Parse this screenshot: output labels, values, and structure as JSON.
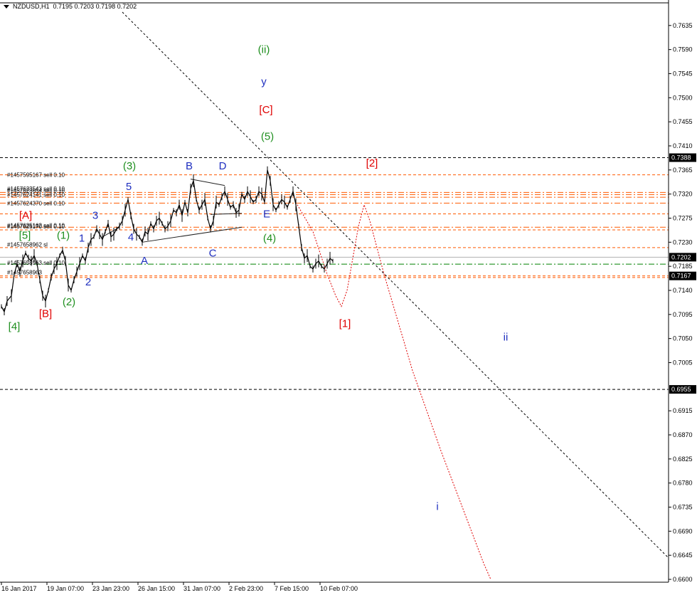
{
  "header": {
    "symbol": "NZDUSD,H1",
    "ohlc": "0.7195 0.7203 0.7198 0.7202"
  },
  "colors": {
    "background": "#ffffff",
    "price": "#000000",
    "sell_line": "#ff5a00",
    "bid_line": "#008000",
    "projection": "#e00000",
    "trendline": "#000000",
    "label_red": "#e00000",
    "label_green": "#1f8f1f",
    "label_blue": "#1f2fbf"
  },
  "chart_data": {
    "type": "line",
    "subtype": "candlestick price chart with Elliott wave markup",
    "symbol": "NZDUSD",
    "timeframe": "H1",
    "y_range": [
      0.66,
      0.766
    ],
    "y_ticks": [
      "0.7635",
      "0.7590",
      "0.7545",
      "0.7500",
      "0.7455",
      "0.7410",
      "0.7365",
      "0.7320",
      "0.7275",
      "0.7230",
      "0.7185",
      "0.7140",
      "0.7095",
      "0.7050",
      "0.7005",
      "0.6915",
      "0.6870",
      "0.6825",
      "0.6780",
      "0.6735",
      "0.6690",
      "0.6645",
      "0.6600"
    ],
    "x_range": [
      0,
      940
    ],
    "x_ticks": [
      {
        "label": "16 Jan 2017",
        "x": 2
      },
      {
        "label": "19 Jan 07:00",
        "x": 66
      },
      {
        "label": "23 Jan 23:00",
        "x": 130
      },
      {
        "label": "26 Jan 15:00",
        "x": 194
      },
      {
        "label": "31 Jan 07:00",
        "x": 258
      },
      {
        "label": "2 Feb 23:00",
        "x": 322
      },
      {
        "label": "7 Feb 15:00",
        "x": 386
      },
      {
        "label": "10 Feb 07:00",
        "x": 450
      }
    ],
    "price_series": {
      "name": "NZDUSD",
      "points": [
        [
          2,
          0.711
        ],
        [
          6,
          0.71
        ],
        [
          10,
          0.712
        ],
        [
          16,
          0.713
        ],
        [
          20,
          0.717
        ],
        [
          24,
          0.719
        ],
        [
          28,
          0.7175
        ],
        [
          32,
          0.7195
        ],
        [
          36,
          0.721
        ],
        [
          40,
          0.72
        ],
        [
          44,
          0.7195
        ],
        [
          48,
          0.7205
        ],
        [
          52,
          0.719
        ],
        [
          56,
          0.716
        ],
        [
          60,
          0.713
        ],
        [
          64,
          0.712
        ],
        [
          68,
          0.714
        ],
        [
          72,
          0.7165
        ],
        [
          76,
          0.718
        ],
        [
          80,
          0.719
        ],
        [
          84,
          0.7205
        ],
        [
          88,
          0.7215
        ],
        [
          92,
          0.7195
        ],
        [
          96,
          0.715
        ],
        [
          100,
          0.714
        ],
        [
          104,
          0.716
        ],
        [
          108,
          0.7175
        ],
        [
          112,
          0.719
        ],
        [
          116,
          0.7205
        ],
        [
          120,
          0.7195
        ],
        [
          124,
          0.722
        ],
        [
          128,
          0.7235
        ],
        [
          132,
          0.724
        ],
        [
          136,
          0.7255
        ],
        [
          140,
          0.7245
        ],
        [
          144,
          0.7235
        ],
        [
          148,
          0.725
        ],
        [
          152,
          0.7265
        ],
        [
          156,
          0.724
        ],
        [
          160,
          0.7245
        ],
        [
          164,
          0.7255
        ],
        [
          168,
          0.726
        ],
        [
          172,
          0.727
        ],
        [
          176,
          0.729
        ],
        [
          180,
          0.731
        ],
        [
          184,
          0.728
        ],
        [
          188,
          0.7255
        ],
        [
          192,
          0.7245
        ],
        [
          196,
          0.724
        ],
        [
          200,
          0.723
        ],
        [
          204,
          0.725
        ],
        [
          208,
          0.7245
        ],
        [
          212,
          0.7265
        ],
        [
          216,
          0.7255
        ],
        [
          220,
          0.727
        ],
        [
          224,
          0.7275
        ],
        [
          228,
          0.7265
        ],
        [
          232,
          0.7255
        ],
        [
          236,
          0.726
        ],
        [
          240,
          0.727
        ],
        [
          244,
          0.729
        ],
        [
          248,
          0.7285
        ],
        [
          252,
          0.73
        ],
        [
          256,
          0.728
        ],
        [
          260,
          0.7305
        ],
        [
          264,
          0.7285
        ],
        [
          268,
          0.733
        ],
        [
          272,
          0.7345
        ],
        [
          276,
          0.731
        ],
        [
          280,
          0.729
        ],
        [
          284,
          0.73
        ],
        [
          288,
          0.731
        ],
        [
          292,
          0.7275
        ],
        [
          296,
          0.7255
        ],
        [
          300,
          0.727
        ],
        [
          304,
          0.7305
        ],
        [
          308,
          0.73
        ],
        [
          312,
          0.7315
        ],
        [
          316,
          0.7325
        ],
        [
          320,
          0.731
        ],
        [
          324,
          0.7295
        ],
        [
          328,
          0.73
        ],
        [
          332,
          0.7285
        ],
        [
          336,
          0.729
        ],
        [
          340,
          0.732
        ],
        [
          344,
          0.731
        ],
        [
          348,
          0.7325
        ],
        [
          352,
          0.7315
        ],
        [
          356,
          0.7305
        ],
        [
          360,
          0.731
        ],
        [
          364,
          0.7325
        ],
        [
          368,
          0.732
        ],
        [
          372,
          0.7305
        ],
        [
          376,
          0.7365
        ],
        [
          380,
          0.7345
        ],
        [
          384,
          0.73
        ],
        [
          388,
          0.729
        ],
        [
          392,
          0.73
        ],
        [
          396,
          0.731
        ],
        [
          400,
          0.7305
        ],
        [
          404,
          0.7295
        ],
        [
          408,
          0.731
        ],
        [
          412,
          0.7325
        ],
        [
          416,
          0.73
        ],
        [
          420,
          0.726
        ],
        [
          424,
          0.722
        ],
        [
          428,
          0.72
        ],
        [
          432,
          0.7205
        ],
        [
          436,
          0.7185
        ],
        [
          440,
          0.718
        ],
        [
          444,
          0.719
        ],
        [
          448,
          0.7195
        ],
        [
          452,
          0.7185
        ],
        [
          456,
          0.718
        ],
        [
          460,
          0.719
        ],
        [
          464,
          0.72
        ],
        [
          468,
          0.7195
        ]
      ]
    },
    "horizontal_lines": [
      {
        "price": 0.7388,
        "style": "dashed",
        "color": "#000000",
        "marker": "0.7388"
      },
      {
        "price": 0.7356,
        "style": "dashed",
        "color": "#ff5a00"
      },
      {
        "price": 0.7323,
        "style": "dashdot",
        "color": "#ff5a00"
      },
      {
        "price": 0.7319,
        "style": "dashdot",
        "color": "#ff5a00"
      },
      {
        "price": 0.7314,
        "style": "dashdot",
        "color": "#ff5a00"
      },
      {
        "price": 0.7303,
        "style": "dashdot",
        "color": "#ff5a00"
      },
      {
        "price": 0.7283,
        "style": "dashed",
        "color": "#ff5a00"
      },
      {
        "price": 0.7258,
        "style": "dashdot",
        "color": "#ff5a00"
      },
      {
        "price": 0.7253,
        "style": "dashed",
        "color": "#ff5a00"
      },
      {
        "price": 0.722,
        "style": "dashed",
        "color": "#ff5a00"
      },
      {
        "price": 0.7202,
        "style": "solid",
        "color": "#b0b0b0",
        "marker": "0.7202"
      },
      {
        "price": 0.7189,
        "style": "dashdot",
        "color": "#008000"
      },
      {
        "price": 0.7167,
        "style": "dashed",
        "color": "#ff5a00",
        "marker": "0.7167"
      },
      {
        "price": 0.7164,
        "style": "dashed",
        "color": "#ff5a00"
      },
      {
        "price": 0.6955,
        "style": "dashed",
        "color": "#000000",
        "marker": "0.6955"
      }
    ],
    "order_labels": [
      {
        "text": "#1457595167 sell 0.10",
        "price": 0.7356
      },
      {
        "text": "#1457623543 sell 0.10",
        "price": 0.733
      },
      {
        "text": "#1457623654 sell 0.10",
        "price": 0.7327
      },
      {
        "text": "#1457624141 sell 0.10",
        "price": 0.7319
      },
      {
        "text": "#1457624370 sell 0.10",
        "price": 0.7303
      },
      {
        "text": "#1457625162 sell 0.10",
        "price": 0.7262
      },
      {
        "text": "#1457625170 sell 0.10",
        "price": 0.726
      },
      {
        "text": "#1457658962 sl",
        "price": 0.7226
      },
      {
        "text": "#1457658963 sell 0.10",
        "price": 0.7192
      },
      {
        "text": "#1457658963",
        "price": 0.7174
      }
    ],
    "projection_path": [
      [
        418,
        0.73
      ],
      [
        440,
        0.725
      ],
      [
        460,
        0.717
      ],
      [
        472,
        0.713
      ],
      [
        480,
        0.711
      ],
      [
        488,
        0.714
      ],
      [
        496,
        0.72
      ],
      [
        504,
        0.726
      ],
      [
        512,
        0.73
      ],
      [
        520,
        0.727
      ],
      [
        540,
        0.717
      ],
      [
        560,
        0.708
      ],
      [
        580,
        0.699
      ],
      [
        600,
        0.6915
      ],
      [
        620,
        0.684
      ],
      [
        640,
        0.677
      ],
      [
        660,
        0.67
      ],
      [
        680,
        0.663
      ],
      [
        690,
        0.66
      ]
    ],
    "trendline": [
      [
        172,
        0.766
      ],
      [
        940,
        0.664
      ]
    ],
    "triangle_lines": [
      [
        [
          268,
          0.7348
        ],
        [
          316,
          0.7336
        ]
      ],
      [
        [
          200,
          0.723
        ],
        [
          340,
          0.7258
        ]
      ],
      [
        [
          296,
          0.7282
        ],
        [
          340,
          0.7284
        ]
      ]
    ],
    "small_channel": [
      [
        144,
        0.724
      ],
      [
        168,
        0.7258
      ]
    ],
    "wave_labels": [
      {
        "text": "(ii)",
        "x": 371,
        "price": 0.759,
        "color": "green"
      },
      {
        "text": "y",
        "x": 371,
        "price": 0.753,
        "color": "blue"
      },
      {
        "text": "[C]",
        "x": 374,
        "price": 0.7478,
        "color": "red"
      },
      {
        "text": "(5)",
        "x": 376,
        "price": 0.7428,
        "color": "green"
      },
      {
        "text": "(3)",
        "x": 182,
        "price": 0.7373,
        "color": "green"
      },
      {
        "text": "B",
        "x": 266,
        "price": 0.7373,
        "color": "blue"
      },
      {
        "text": "D",
        "x": 313,
        "price": 0.7373,
        "color": "blue"
      },
      {
        "text": "[2]",
        "x": 523,
        "price": 0.7378,
        "color": "red"
      },
      {
        "text": "5",
        "x": 181,
        "price": 0.7334,
        "color": "blue"
      },
      {
        "text": "3",
        "x": 134,
        "price": 0.728,
        "color": "blue"
      },
      {
        "text": "E",
        "x": 375,
        "price": 0.7283,
        "color": "blue"
      },
      {
        "text": "[A]",
        "x": 36,
        "price": 0.728,
        "color": "red"
      },
      {
        "text": "[5]",
        "x": 35,
        "price": 0.7243,
        "color": "green"
      },
      {
        "text": "(1)",
        "x": 89,
        "price": 0.7243,
        "color": "green"
      },
      {
        "text": "1",
        "x": 115,
        "price": 0.7238,
        "color": "blue"
      },
      {
        "text": "4",
        "x": 184,
        "price": 0.724,
        "color": "blue"
      },
      {
        "text": "(4)",
        "x": 379,
        "price": 0.7238,
        "color": "green"
      },
      {
        "text": "C",
        "x": 299,
        "price": 0.721,
        "color": "blue"
      },
      {
        "text": "A",
        "x": 203,
        "price": 0.7196,
        "color": "blue"
      },
      {
        "text": "2",
        "x": 124,
        "price": 0.7156,
        "color": "blue"
      },
      {
        "text": "(2)",
        "x": 97,
        "price": 0.7119,
        "color": "green"
      },
      {
        "text": "[B]",
        "x": 64,
        "price": 0.7097,
        "color": "red"
      },
      {
        "text": "[4]",
        "x": 20,
        "price": 0.7073,
        "color": "green"
      },
      {
        "text": "[1]",
        "x": 485,
        "price": 0.7078,
        "color": "red"
      },
      {
        "text": "ii",
        "x": 711,
        "price": 0.7053,
        "color": "blue"
      },
      {
        "text": "i",
        "x": 615,
        "price": 0.6736,
        "color": "blue"
      }
    ]
  }
}
